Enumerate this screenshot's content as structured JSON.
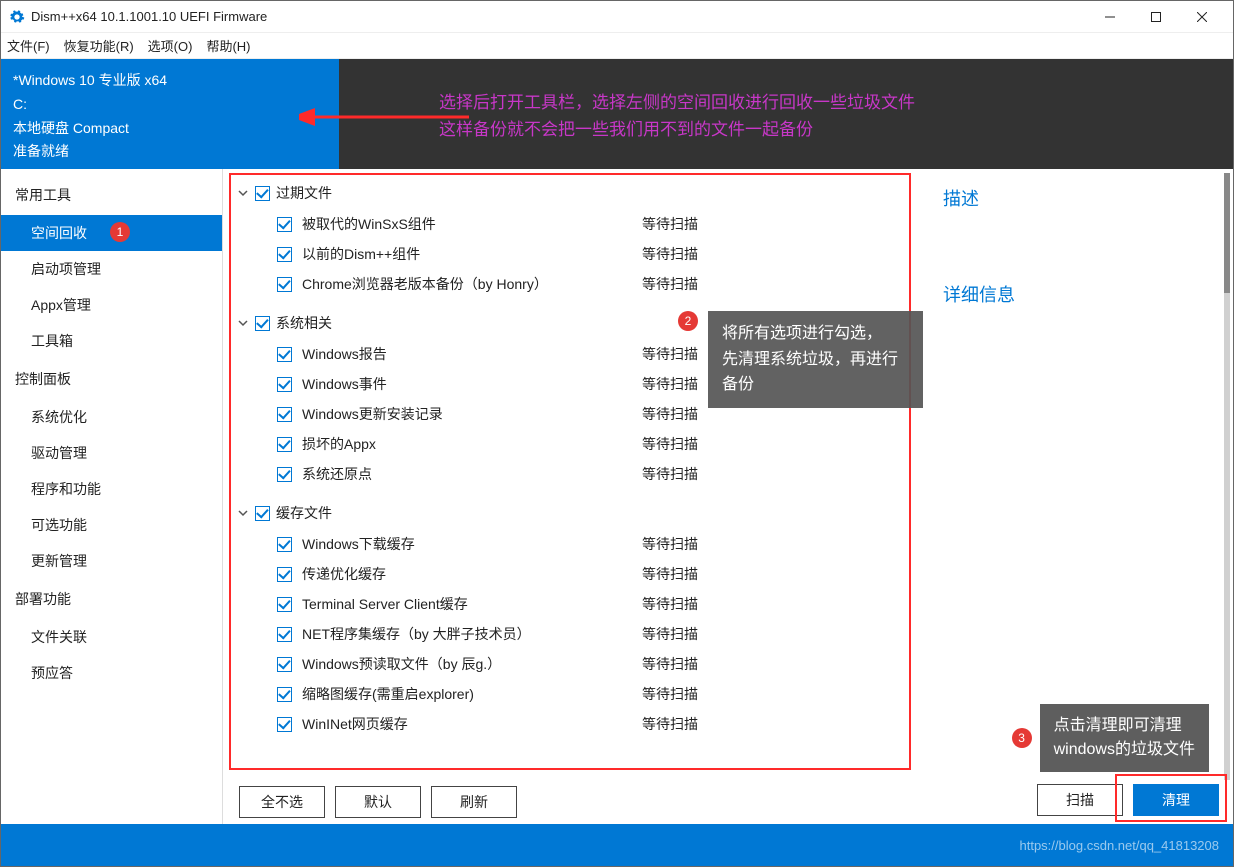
{
  "titlebar": {
    "title": "Dism++x64 10.1.1001.10 UEFI Firmware"
  },
  "menu": {
    "file": "文件(F)",
    "recover": "恢复功能(R)",
    "options": "选项(O)",
    "help": "帮助(H)"
  },
  "info": {
    "line1": "*Windows 10 专业版 x64",
    "line2": "C:",
    "line3": "本地硬盘 Compact",
    "line4": "准备就绪"
  },
  "annotation_top": {
    "line1": "选择后打开工具栏，选择左侧的空间回收进行回收一些垃圾文件",
    "line2": "这样备份就不会把一些我们用不到的文件一起备份"
  },
  "sidebar": {
    "groups": [
      {
        "title": "常用工具",
        "items": [
          {
            "label": "空间回收",
            "active": true,
            "badge": "1"
          },
          {
            "label": "启动项管理"
          },
          {
            "label": "Appx管理"
          },
          {
            "label": "工具箱"
          }
        ]
      },
      {
        "title": "控制面板",
        "items": [
          {
            "label": "系统优化"
          },
          {
            "label": "驱动管理"
          },
          {
            "label": "程序和功能"
          },
          {
            "label": "可选功能"
          },
          {
            "label": "更新管理"
          }
        ]
      },
      {
        "title": "部署功能",
        "items": [
          {
            "label": "文件关联"
          },
          {
            "label": "预应答"
          }
        ]
      }
    ]
  },
  "list": {
    "groups": [
      {
        "title": "过期文件",
        "items": [
          {
            "name": "被取代的WinSxS组件",
            "status": "等待扫描"
          },
          {
            "name": "以前的Dism++组件",
            "status": "等待扫描"
          },
          {
            "name": "Chrome浏览器老版本备份（by Honry）",
            "status": "等待扫描"
          }
        ]
      },
      {
        "title": "系统相关",
        "items": [
          {
            "name": "Windows报告",
            "status": "等待扫描"
          },
          {
            "name": "Windows事件",
            "status": "等待扫描"
          },
          {
            "name": "Windows更新安装记录",
            "status": "等待扫描"
          },
          {
            "name": "损坏的Appx",
            "status": "等待扫描"
          },
          {
            "name": "系统还原点",
            "status": "等待扫描"
          }
        ]
      },
      {
        "title": "缓存文件",
        "items": [
          {
            "name": "Windows下载缓存",
            "status": "等待扫描"
          },
          {
            "name": "传递优化缓存",
            "status": "等待扫描"
          },
          {
            "name": "Terminal Server Client缓存",
            "status": "等待扫描"
          },
          {
            "name": "NET程序集缓存（by 大胖子技术员）",
            "status": "等待扫描"
          },
          {
            "name": "Windows预读取文件（by 辰g.）",
            "status": "等待扫描"
          },
          {
            "name": "缩略图缓存(需重启explorer)",
            "status": "等待扫描"
          },
          {
            "name": "WinINet网页缓存",
            "status": "等待扫描"
          }
        ]
      }
    ]
  },
  "annotation2": {
    "badge": "2",
    "line1": "将所有选项进行勾选，",
    "line2": "先清理系统垃圾，再进行备份"
  },
  "rightpane": {
    "desc": "描述",
    "detail": "详细信息"
  },
  "buttons": {
    "none": "全不选",
    "default": "默认",
    "refresh": "刷新",
    "scan": "扫描",
    "clean": "清理"
  },
  "annotation3": {
    "badge": "3",
    "line1": "点击清理即可清理",
    "line2": "windows的垃圾文件"
  },
  "status": {
    "watermark": "https://blog.csdn.net/qq_41813208"
  }
}
